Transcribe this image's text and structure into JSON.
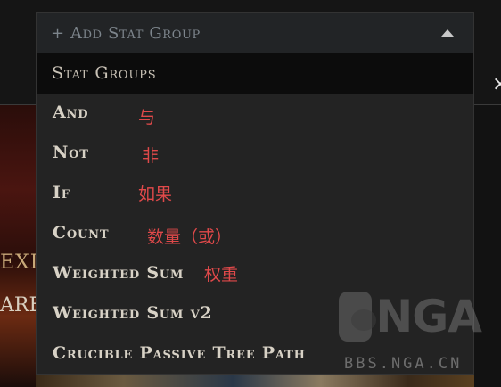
{
  "dropdown": {
    "placeholder": "+ Add Stat Group",
    "header": "Stat Groups",
    "items": [
      {
        "label": "And",
        "note": "与"
      },
      {
        "label": "Not",
        "note": "非"
      },
      {
        "label": "If",
        "note": "如果"
      },
      {
        "label": "Count",
        "note": "数量（或）"
      },
      {
        "label": "Weighted Sum",
        "note": "权重"
      },
      {
        "label": "Weighted Sum v2",
        "note": ""
      },
      {
        "label": "Crucible Passive Tree Path",
        "note": ""
      }
    ]
  },
  "background": {
    "left_text_1": "EXIL",
    "left_text_2": "ARE",
    "close_symbol": "×"
  },
  "watermark": {
    "logo_text": "NGA",
    "url": "BBS.NGA.CN"
  },
  "colors": {
    "accent_note": "#e0494a",
    "item_text": "#d8d2c6",
    "placeholder_text": "#7d858c"
  },
  "icons": {
    "caret": "caret-up-icon",
    "close": "close-icon",
    "watermark": "paw-logo-icon"
  }
}
